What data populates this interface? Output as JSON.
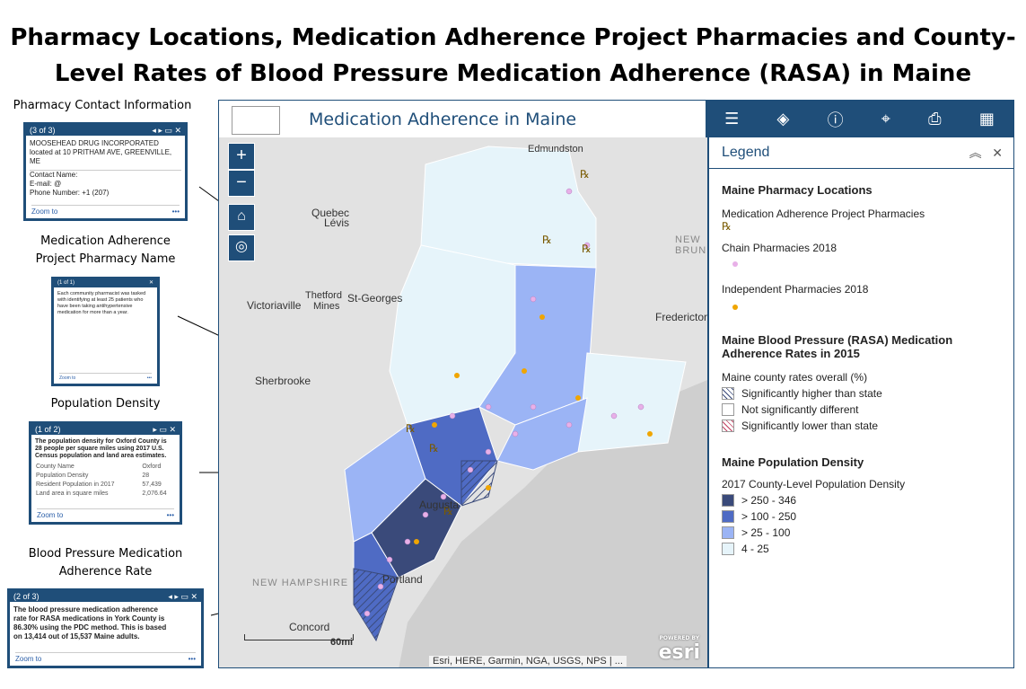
{
  "title": {
    "line1": "Pharmacy Locations, Medication Adherence Project Pharmacies and County-",
    "line2": "Level Rates of Blood Pressure Medication Adherence (RASA) in Maine"
  },
  "callouts": [
    {
      "label": "Pharmacy Contact Information",
      "popup": {
        "header": "(3 of 3)",
        "lines": [
          "MOOSEHEAD DRUG INCORPORATED",
          "located at 10 PRITHAM AVE, GREENVILLE,",
          "ME",
          "Contact Name:",
          "E-mail:          @",
          "Phone Number: +1 (207)"
        ],
        "zoom": "Zoom to"
      }
    },
    {
      "label_line1": "Medication Adherence",
      "label_line2": "Project Pharmacy Name",
      "popup": {
        "header": "(1 of 1)",
        "lines": [
          "Each community pharmacist was tasked",
          "with identifying at least 25 patients who",
          "have been taking antihypertensive",
          "medication for more than a year."
        ],
        "zoom": "Zoom to"
      }
    },
    {
      "label": "Population Density",
      "popup": {
        "header": "(1 of 2)",
        "lines": [
          "The population density for Oxford County is",
          "28 people per square miles using 2017 U.S.",
          "Census population and land area estimates."
        ],
        "table": [
          [
            "County Name",
            "Oxford"
          ],
          [
            "Population Density",
            "28"
          ],
          [
            "Resident Population in 2017",
            "57,439"
          ],
          [
            "Land area in square miles",
            "2,076.64"
          ]
        ],
        "zoom": "Zoom to"
      }
    },
    {
      "label_line1": "Blood Pressure Medication",
      "label_line2": "Adherence Rate",
      "popup": {
        "header": "(2 of 3)",
        "lines": [
          "The blood pressure medication adherence",
          "rate for RASA medications in York County is",
          "86.30% using the PDC method. This is based",
          "on 13,414 out of 15,537 Maine adults."
        ],
        "zoom": "Zoom to"
      }
    }
  ],
  "app": {
    "title": "Medication Adherence in Maine",
    "toolbar": [
      "list-icon",
      "layers-icon",
      "info-icon",
      "locate-icon",
      "print-icon",
      "grid-icon"
    ],
    "map_labels": [
      "Edmundston",
      "Quebec",
      "Lévis",
      "Thetford",
      "Mines",
      "St-Georges",
      "Victoriaville",
      "Sherbrooke",
      "NEW BRUN",
      "Fredericton",
      "Augusta",
      "Portland",
      "NEW HAMPSHIRE",
      "Concord",
      "60mi"
    ],
    "attribution": "Esri, HERE, Garmin, NGA, USGS, NPS | ...",
    "esri_powered": "POWERED BY",
    "esri": "esri"
  },
  "legend": {
    "title": "Legend",
    "section1": "Maine Pharmacy Locations",
    "map_proj": "Medication Adherence Project Pharmacies",
    "chain": "Chain Pharmacies 2018",
    "independent": "Independent Pharmacies 2018",
    "section2_line1": "Maine Blood Pressure (RASA) Medication",
    "section2_line2": "Adherence Rates in 2015",
    "overall": "Maine county rates overall (%)",
    "rates": [
      "Significantly higher than state",
      "Not significantly different",
      "Significantly lower than state"
    ],
    "section3": "Maine Population Density",
    "density_sub": "2017 County-Level Population Density",
    "density": [
      {
        "label": "> 250 - 346",
        "color": "#3a4a7a"
      },
      {
        "label": "> 100 - 250",
        "color": "#4f6bc4"
      },
      {
        "label": "> 25 - 100",
        "color": "#9bb4f5"
      },
      {
        "label": "4 - 25",
        "color": "#e6f4fa"
      }
    ]
  }
}
